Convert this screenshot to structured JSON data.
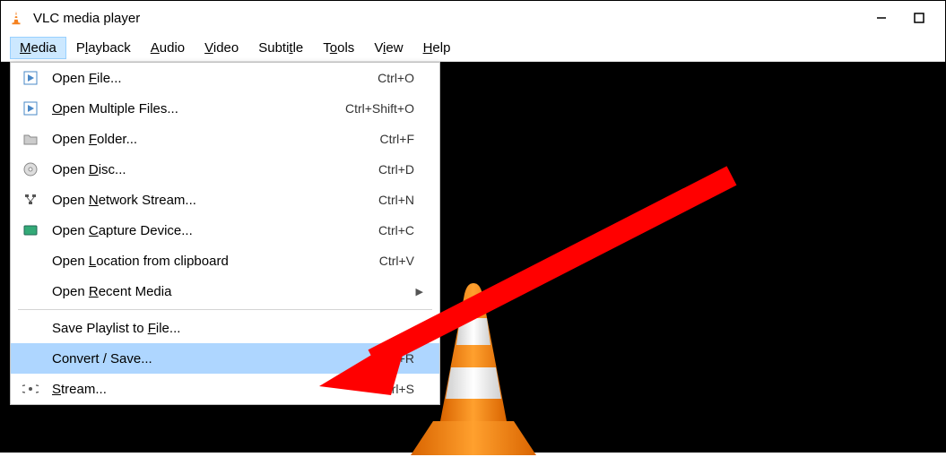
{
  "window": {
    "title": "VLC media player",
    "controls": {
      "minimize": "—",
      "maximize": "▢",
      "close": "✕"
    }
  },
  "menubar": [
    {
      "label": "Media",
      "hotkey_index": 0,
      "open": true
    },
    {
      "label": "Playback",
      "hotkey_index": 0
    },
    {
      "label": "Audio",
      "hotkey_index": 0
    },
    {
      "label": "Video",
      "hotkey_index": 0
    },
    {
      "label": "Subtitle",
      "hotkey_index": 0
    },
    {
      "label": "Tools",
      "hotkey_index": 0
    },
    {
      "label": "View",
      "hotkey_index": 3
    },
    {
      "label": "Help",
      "hotkey_index": 0
    }
  ],
  "media_menu": {
    "items": [
      {
        "icon": "play-file",
        "label": "Open File...",
        "uchar": "F",
        "shortcut": "Ctrl+O"
      },
      {
        "icon": "play-file",
        "label": "Open Multiple Files...",
        "uchar": "O",
        "shortcut": "Ctrl+Shift+O"
      },
      {
        "icon": "folder",
        "label": "Open Folder...",
        "uchar": "F",
        "shortcut": "Ctrl+F"
      },
      {
        "icon": "disc",
        "label": "Open Disc...",
        "uchar": "D",
        "shortcut": "Ctrl+D"
      },
      {
        "icon": "network",
        "label": "Open Network Stream...",
        "uchar": "N",
        "shortcut": "Ctrl+N"
      },
      {
        "icon": "capture",
        "label": "Open Capture Device...",
        "uchar": "C",
        "shortcut": "Ctrl+C"
      },
      {
        "icon": "",
        "label": "Open Location from clipboard",
        "uchar": "L",
        "shortcut": "Ctrl+V"
      },
      {
        "icon": "",
        "label": "Open Recent Media",
        "uchar": "R",
        "shortcut": "",
        "submenu": true
      },
      {
        "separator": true
      },
      {
        "icon": "",
        "label": "Save Playlist to File...",
        "uchar": "F",
        "shortcut": ""
      },
      {
        "icon": "",
        "label": "Convert / Save...",
        "uchar": "",
        "shortcut": "Ctrl+R",
        "highlight": true
      },
      {
        "icon": "stream",
        "label": "Stream...",
        "uchar": "S",
        "shortcut": "Ctrl+S"
      }
    ]
  },
  "annotation": {
    "arrow_color": "#ff0000"
  }
}
